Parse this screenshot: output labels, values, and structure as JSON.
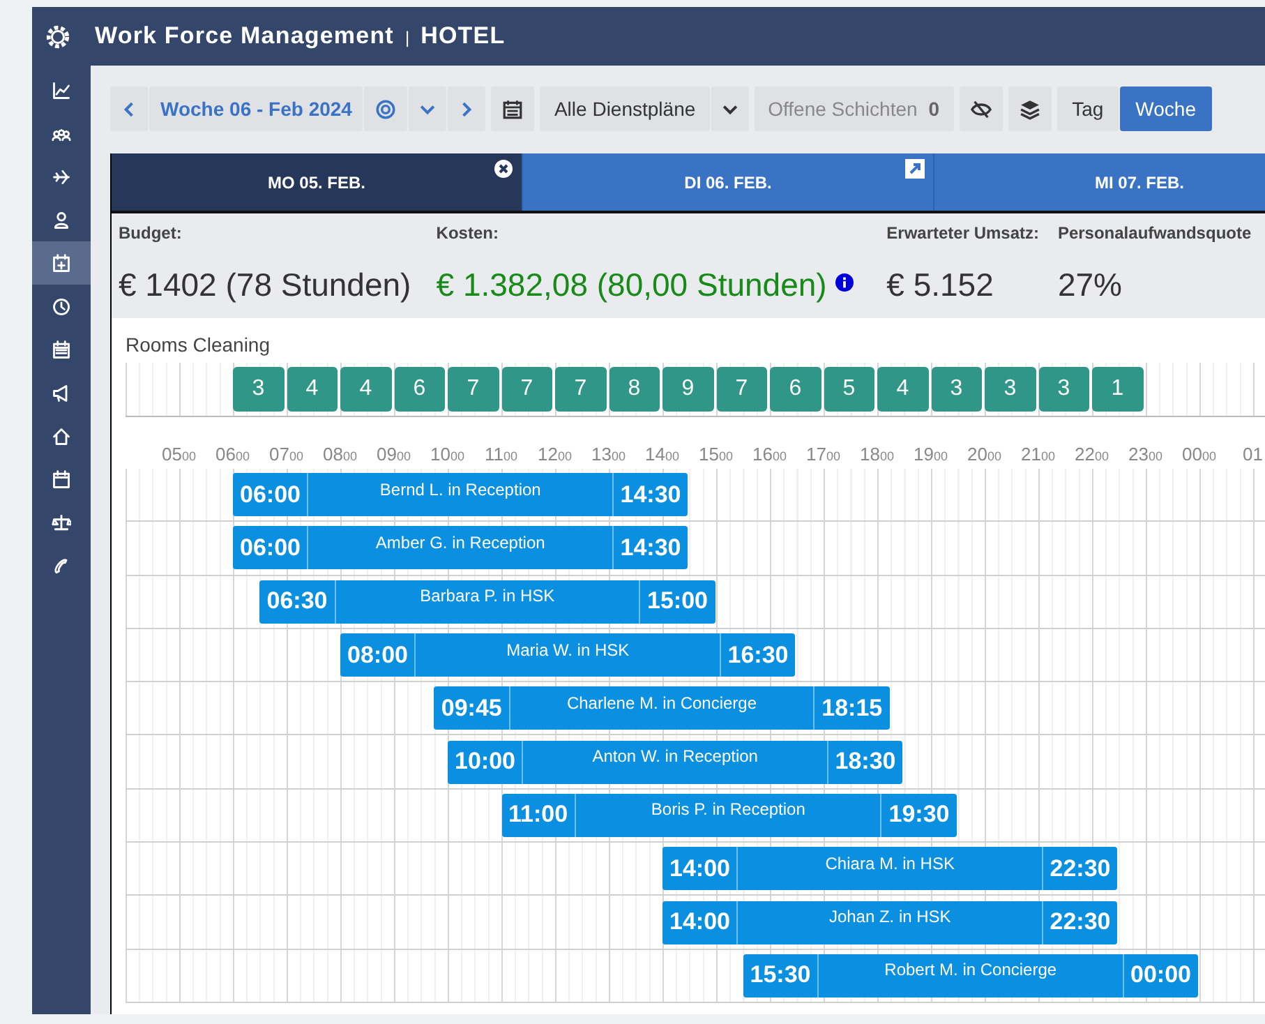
{
  "header": {
    "title": "Work Force Management",
    "separator": "|",
    "subtitle": "HOTEL"
  },
  "sidebar": {
    "items": [
      {
        "kind": "chart",
        "selected": false
      },
      {
        "kind": "users",
        "selected": false
      },
      {
        "kind": "plane",
        "selected": false
      },
      {
        "kind": "person",
        "selected": false
      },
      {
        "kind": "calendar-plus",
        "selected": true
      },
      {
        "kind": "clock",
        "selected": false
      },
      {
        "kind": "calendar",
        "selected": false
      },
      {
        "kind": "megaphone",
        "selected": false
      },
      {
        "kind": "home",
        "selected": false
      },
      {
        "kind": "calendar-blank",
        "selected": false
      },
      {
        "kind": "scale",
        "selected": false
      },
      {
        "kind": "phone",
        "selected": false
      }
    ]
  },
  "toolbar": {
    "week": "Woche 06 - Feb 2024",
    "roster": "Alle Dienstpläne",
    "open_shifts": {
      "label": "Offene Schichten",
      "count": "0"
    },
    "views": [
      {
        "label": "Tag",
        "selected": false
      },
      {
        "label": "Woche",
        "selected": true
      }
    ]
  },
  "day_tabs": [
    {
      "label": "MO 05. FEB.",
      "selected": true,
      "close_button": true
    },
    {
      "label": "DI 06. FEB.",
      "selected": false,
      "expand_button": true
    },
    {
      "label": "MI 07. FEB.",
      "selected": false
    }
  ],
  "stats": [
    {
      "label": "Budget:",
      "value": "€ 1402 (78 Stunden)",
      "positive": false,
      "info": false
    },
    {
      "label": "Kosten:",
      "value": "€ 1.382,08 (80,00 Stunden)",
      "positive": true,
      "info": true
    },
    {
      "label": "Erwarteter Umsatz:",
      "value": "€ 5.152",
      "positive": false,
      "info": false
    },
    {
      "label": "Personalaufwandsquote",
      "value": "27%",
      "positive": false,
      "info": false
    }
  ],
  "demand": {
    "title": "Rooms Cleaning",
    "counts": [
      "3",
      "4",
      "4",
      "6",
      "7",
      "7",
      "7",
      "8",
      "9",
      "7",
      "6",
      "5",
      "4",
      "3",
      "3",
      "3",
      "1"
    ]
  },
  "hours": [
    {
      "hour": "05",
      "minutes": "00"
    },
    {
      "hour": "06",
      "minutes": "00"
    },
    {
      "hour": "07",
      "minutes": "00"
    },
    {
      "hour": "08",
      "minutes": "00"
    },
    {
      "hour": "09",
      "minutes": "00"
    },
    {
      "hour": "10",
      "minutes": "00"
    },
    {
      "hour": "11",
      "minutes": "00"
    },
    {
      "hour": "12",
      "minutes": "00"
    },
    {
      "hour": "13",
      "minutes": "00"
    },
    {
      "hour": "14",
      "minutes": "00"
    },
    {
      "hour": "15",
      "minutes": "00"
    },
    {
      "hour": "16",
      "minutes": "00"
    },
    {
      "hour": "17",
      "minutes": "00"
    },
    {
      "hour": "18",
      "minutes": "00"
    },
    {
      "hour": "19",
      "minutes": "00"
    },
    {
      "hour": "20",
      "minutes": "00"
    },
    {
      "hour": "21",
      "minutes": "00"
    },
    {
      "hour": "22",
      "minutes": "00"
    },
    {
      "hour": "23",
      "minutes": "00"
    },
    {
      "hour": "00",
      "minutes": "00"
    },
    {
      "hour": "01"
    }
  ],
  "shifts": [
    {
      "start": "06:00",
      "name": "Bernd L. in Reception",
      "end": "14:30"
    },
    {
      "start": "06:00",
      "name": "Amber G. in Reception",
      "end": "14:30"
    },
    {
      "start": "06:30",
      "name": "Barbara P. in HSK",
      "end": "15:00"
    },
    {
      "start": "08:00",
      "name": "Maria W. in HSK",
      "end": "16:30"
    },
    {
      "start": "09:45",
      "name": "Charlene M. in Concierge",
      "end": "18:15"
    },
    {
      "start": "10:00",
      "name": "Anton W. in Reception",
      "end": "18:30"
    },
    {
      "start": "11:00",
      "name": "Boris P. in Reception",
      "end": "19:30"
    },
    {
      "start": "14:00",
      "name": "Chiara M. in HSK",
      "end": "22:30"
    },
    {
      "start": "14:00",
      "name": "Johan Z. in HSK",
      "end": "22:30"
    },
    {
      "start": "15:30",
      "name": "Robert M. in Concierge",
      "end": "00:00"
    }
  ]
}
